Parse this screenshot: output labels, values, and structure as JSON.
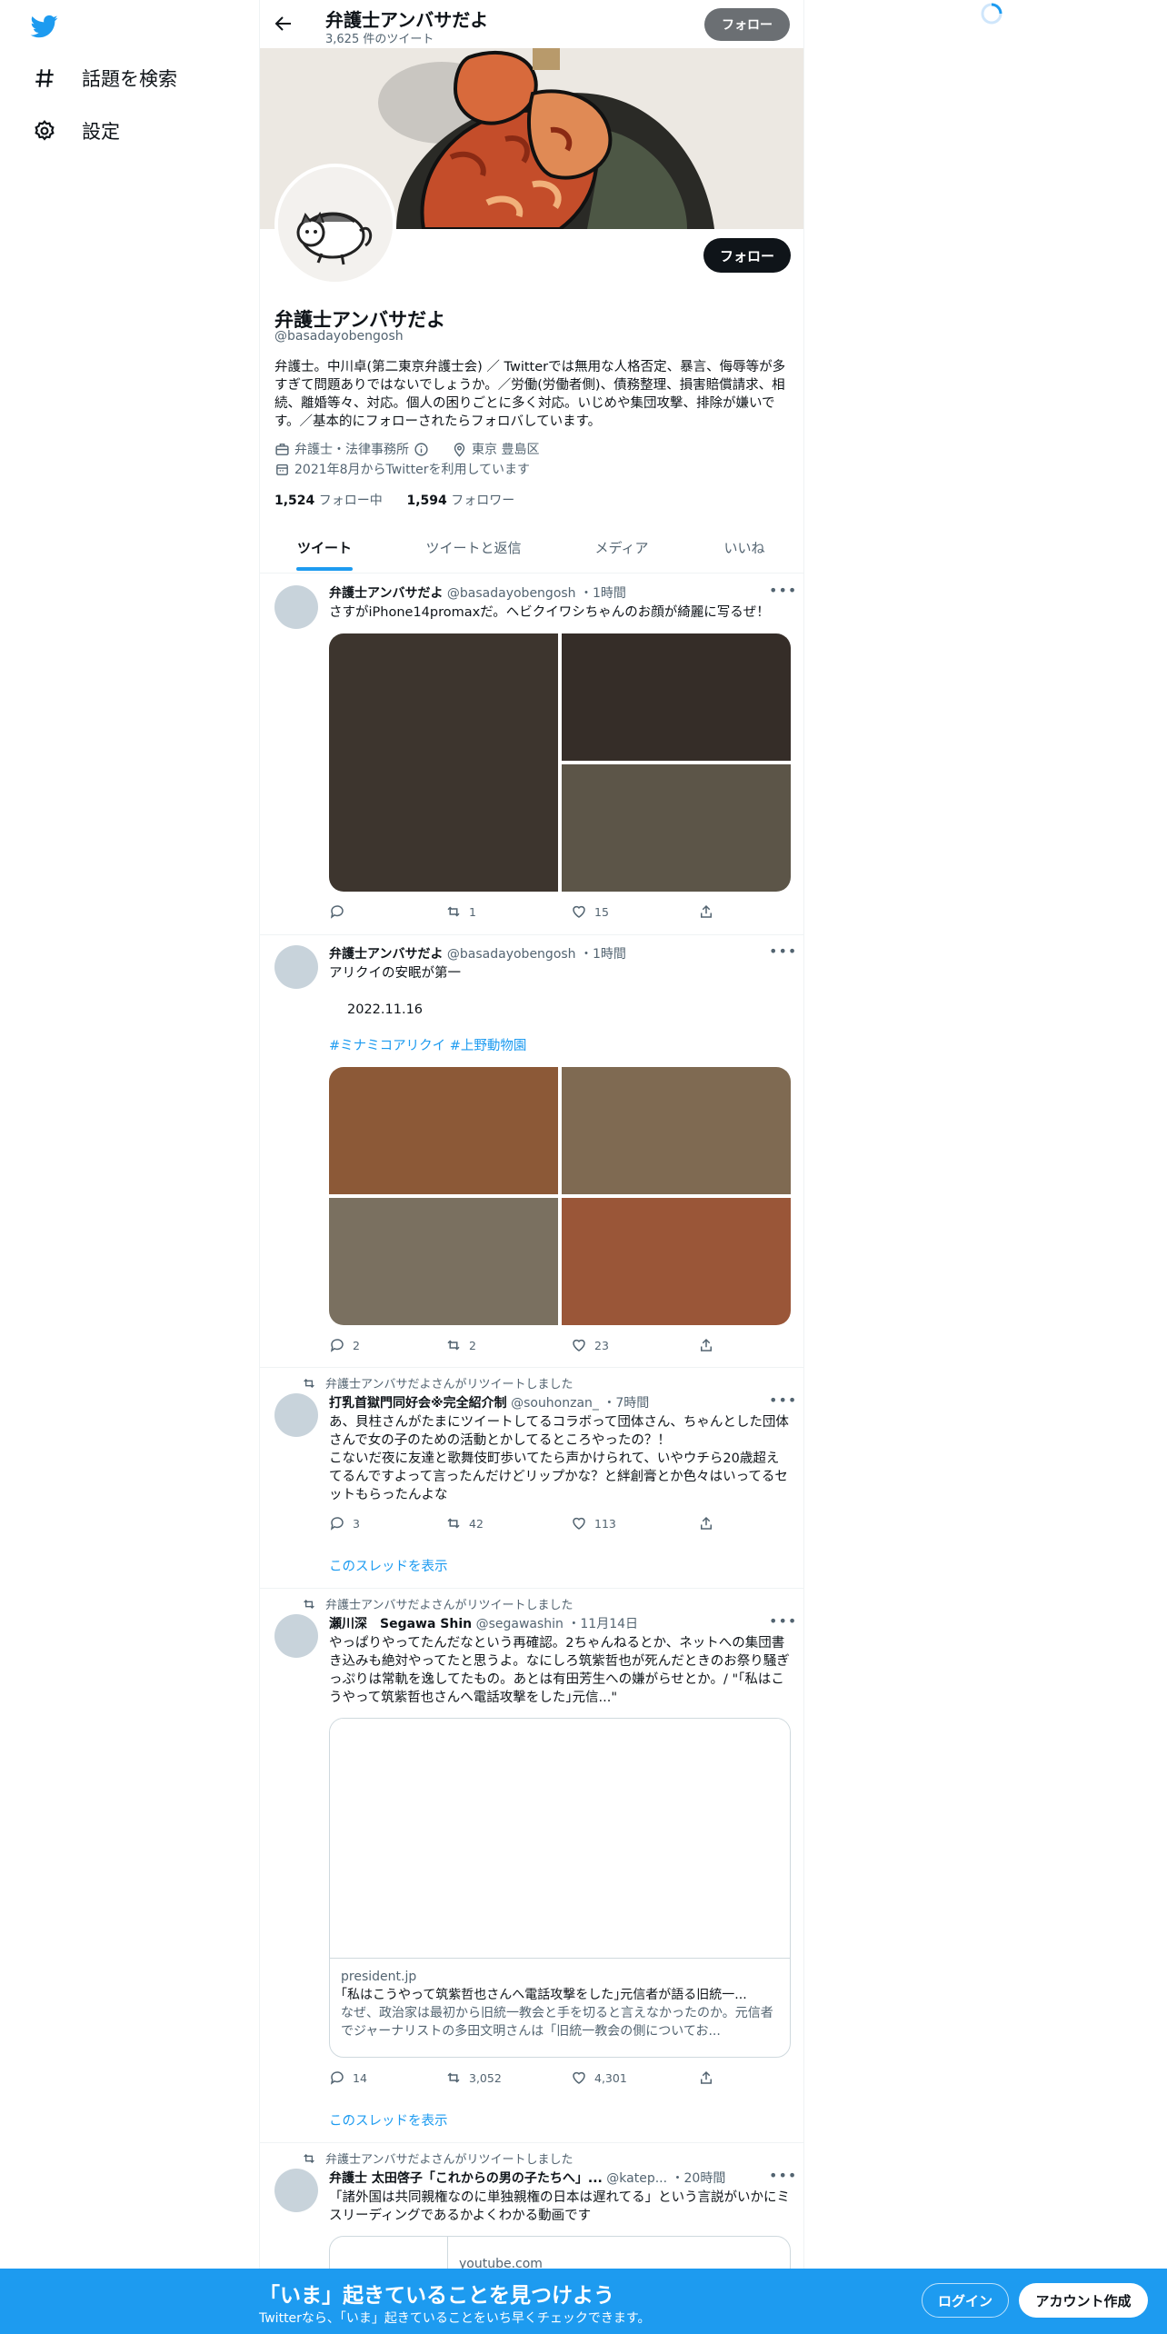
{
  "sidebar": {
    "items": [
      {
        "label": "話題を検索",
        "icon": "hashtag-icon"
      },
      {
        "label": "設定",
        "icon": "gear-icon"
      }
    ]
  },
  "topbar": {
    "name": "弁護士アンバサだよ",
    "tweet_count": "3,625 件のツイート",
    "follow_label": "フォロー"
  },
  "profile": {
    "follow_label": "フォロー",
    "display_name": "弁護士アンバサだよ",
    "handle": "@basadayobengosh",
    "bio": "弁護士。中川卓(第二東京弁護士会) ／ Twitterでは無用な人格否定、暴言、侮辱等が多すぎて問題ありではないでしょうか。／労働(労働者側)、債務整理、損害賠償請求、相続、離婚等々、対応。個人の困りごとに多く対応。いじめや集団攻撃、排除が嫌いです。／基本的にフォローされたらフォロバしています。",
    "category": "弁護士・法律事務所",
    "location": "東京 豊島区",
    "joined": "2021年8月からTwitterを利用しています",
    "following_count": "1,524",
    "following_label": "フォロー中",
    "followers_count": "1,594",
    "followers_label": "フォロワー"
  },
  "tabs": [
    {
      "label": "ツイート",
      "active": true
    },
    {
      "label": "ツイートと返信",
      "active": false
    },
    {
      "label": "メディア",
      "active": false
    },
    {
      "label": "いいね",
      "active": false
    }
  ],
  "tweets": [
    {
      "name": "弁護士アンバサだよ",
      "handle": "@basadayobengosh",
      "time": "・1時間",
      "text": "さすがiPhone14promaxだ。ヘビクイワシちゃんのお顔が綺麗に写るぜ！",
      "replies": "",
      "retweets": "1",
      "likes": "15"
    },
    {
      "name": "弁護士アンバサだよ",
      "handle": "@basadayobengosh",
      "time": "・1時間",
      "text": "アリクイの安眠が第一",
      "date_line": "2022.11.16",
      "hashtags": "#ミナミコアリクイ #上野動物園",
      "replies": "2",
      "retweets": "2",
      "likes": "23"
    },
    {
      "retweeted_by": "弁護士アンバサだよさんがリツイートしました",
      "name": "打乳首獄門同好会※完全紹介制",
      "handle": "@souhonzan_",
      "time": "・7時間",
      "text": "あ、貝柱さんがたまにツイートしてるコラボって団体さん、ちゃんとした団体さんで女の子のための活動とかしてるところやったの？！\nこないだ夜に友達と歌舞伎町歩いてたら声かけられて、いやウチら20歳超えてるんですよって言ったんだけどリップかな？と絆創膏とか色々はいってるセットもらったんよな",
      "replies": "3",
      "retweets": "42",
      "likes": "113",
      "thread_label": "このスレッドを表示"
    },
    {
      "retweeted_by": "弁護士アンバサだよさんがリツイートしました",
      "name": "瀬川深　Segawa Shin",
      "handle": "@segawashin",
      "time": "・11月14日",
      "text": "やっぱりやってたんだなという再確認。2ちゃんねるとか、ネットへの集団書き込みも絶対やってたと思うよ。なにしろ筑紫哲也が死んだときのお祭り騒ぎっぷりは常軌を逸してたもの。あとは有田芳生への嫌がらせとか。/ \"｢私はこうやって筑紫哲也さんへ電話攻撃をした｣元信...\"",
      "card_domain": "president.jp",
      "card_title": "｢私はこうやって筑紫哲也さんへ電話攻撃をした｣元信者が語る旧統一...",
      "card_desc": "なぜ、政治家は最初から旧統一教会と手を切ると言えなかったのか。元信者でジャーナリストの多田文明さんは「旧統一教会の側についてお...",
      "replies": "14",
      "retweets": "3,052",
      "likes": "4,301",
      "thread_label": "このスレッドを表示"
    },
    {
      "retweeted_by": "弁護士アンバサだよさんがリツイートしました",
      "name": "弁護士 太田啓子「これからの男の子たちへ」...",
      "handle": "@katep...",
      "time": "・20時間",
      "text": "「諸外国は共同親権なのに単独親権の日本は遅れてる」という言説がいかにミスリーディングであるかよくわかる動画です",
      "card_domain": "youtube.com"
    }
  ],
  "bottom_bar": {
    "title": "「いま」起きていることを見つけよう",
    "subtitle": "Twitterなら、「いま」起きていることをいち早くチェックできます。",
    "login_label": "ログイン",
    "signup_label": "アカウント作成"
  },
  "colors": {
    "accent": "#1d9bf0",
    "text": "#0f1419",
    "muted": "#536471",
    "border": "#eff3f4"
  }
}
